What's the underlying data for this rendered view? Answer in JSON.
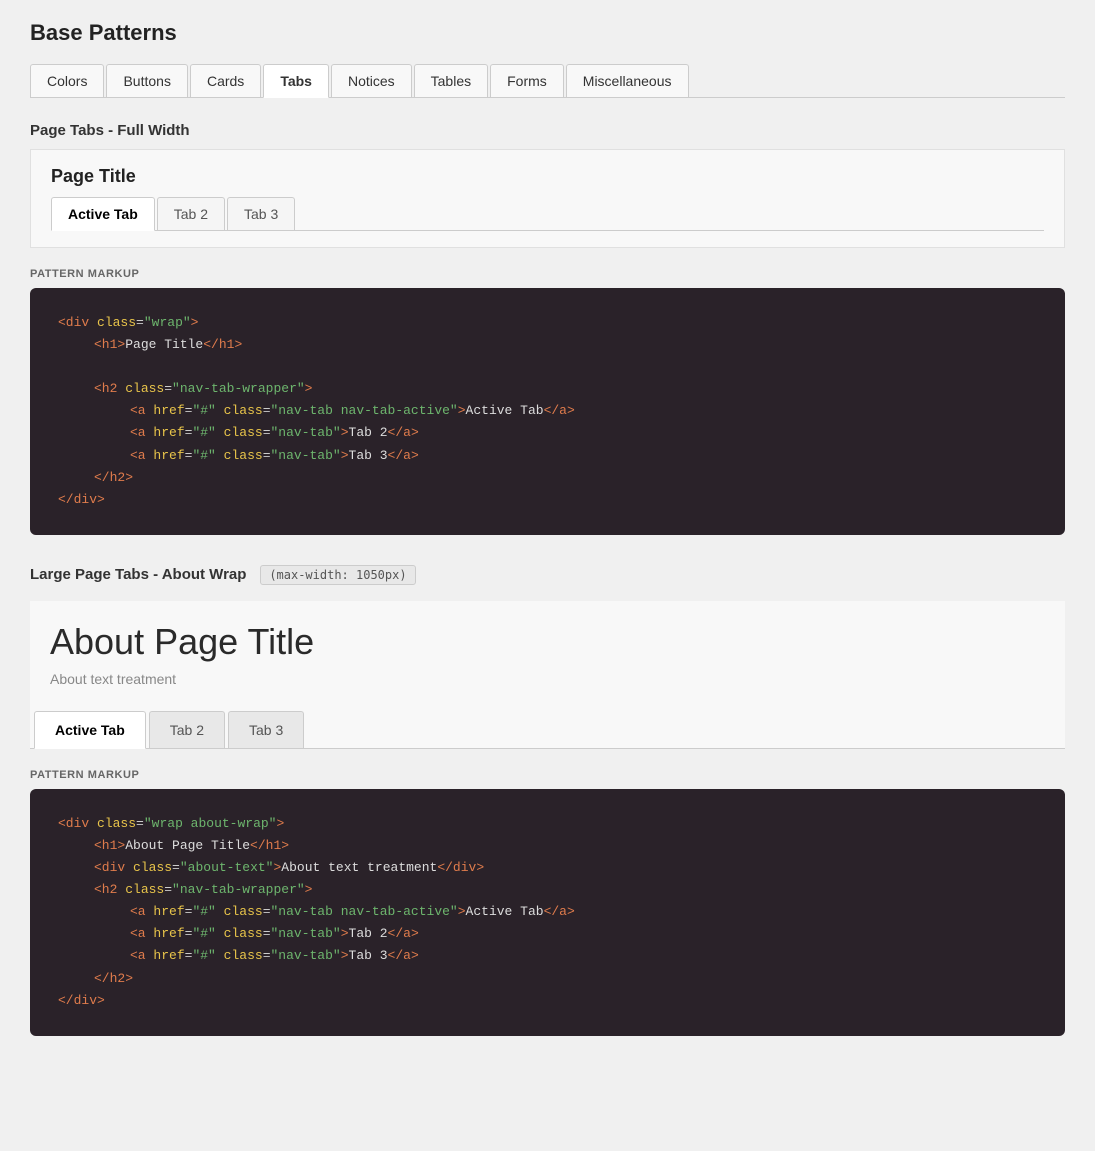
{
  "page": {
    "heading": "Base Patterns"
  },
  "top_nav": {
    "tabs": [
      {
        "label": "Colors",
        "active": false
      },
      {
        "label": "Buttons",
        "active": false
      },
      {
        "label": "Cards",
        "active": false
      },
      {
        "label": "Tabs",
        "active": true
      },
      {
        "label": "Notices",
        "active": false
      },
      {
        "label": "Tables",
        "active": false
      },
      {
        "label": "Forms",
        "active": false
      },
      {
        "label": "Miscellaneous",
        "active": false
      }
    ]
  },
  "section1": {
    "label": "Page Tabs - Full Width",
    "demo": {
      "title": "Page Title",
      "tabs": [
        {
          "label": "Active Tab",
          "active": true
        },
        {
          "label": "Tab 2",
          "active": false
        },
        {
          "label": "Tab 3",
          "active": false
        }
      ]
    },
    "pattern_markup_label": "PATTERN MARKUP",
    "code_lines": [
      {
        "indent": 0,
        "html": "<div class=\"wrap\">"
      },
      {
        "indent": 1,
        "html": "<h1>Page Title</h1>"
      },
      {
        "indent": 0,
        "html": ""
      },
      {
        "indent": 1,
        "html": "<h2 class=\"nav-tab-wrapper\">"
      },
      {
        "indent": 2,
        "html": "<a href=\"#\" class=\"nav-tab nav-tab-active\">Active Tab</a>"
      },
      {
        "indent": 2,
        "html": "<a href=\"#\" class=\"nav-tab\">Tab 2</a>"
      },
      {
        "indent": 2,
        "html": "<a href=\"#\" class=\"nav-tab\">Tab 3</a>"
      },
      {
        "indent": 1,
        "html": "</h2>"
      },
      {
        "indent": 0,
        "html": "</div>"
      }
    ]
  },
  "section2": {
    "label": "Large Page Tabs - About Wrap",
    "max_width_badge": "(max-width: 1050px)",
    "demo": {
      "about_title": "About Page Title",
      "about_text": "About text treatment",
      "tabs": [
        {
          "label": "Active Tab",
          "active": true
        },
        {
          "label": "Tab 2",
          "active": false
        },
        {
          "label": "Tab 3",
          "active": false
        }
      ]
    },
    "pattern_markup_label": "PATTERN MARKUP",
    "code_lines": [
      {
        "indent": 0,
        "html": "<div class=\"wrap about-wrap\">"
      },
      {
        "indent": 1,
        "html": "<h1>About Page Title</h1>"
      },
      {
        "indent": 1,
        "html": "<div class=\"about-text\">About text treatment</div>"
      },
      {
        "indent": 1,
        "html": "<h2 class=\"nav-tab-wrapper\">"
      },
      {
        "indent": 2,
        "html": "<a href=\"#\" class=\"nav-tab nav-tab-active\">Active Tab</a>"
      },
      {
        "indent": 2,
        "html": "<a href=\"#\" class=\"nav-tab\">Tab 2</a>"
      },
      {
        "indent": 2,
        "html": "<a href=\"#\" class=\"nav-tab\">Tab 3</a>"
      },
      {
        "indent": 1,
        "html": "</h2>"
      },
      {
        "indent": 0,
        "html": "</div>"
      }
    ]
  }
}
